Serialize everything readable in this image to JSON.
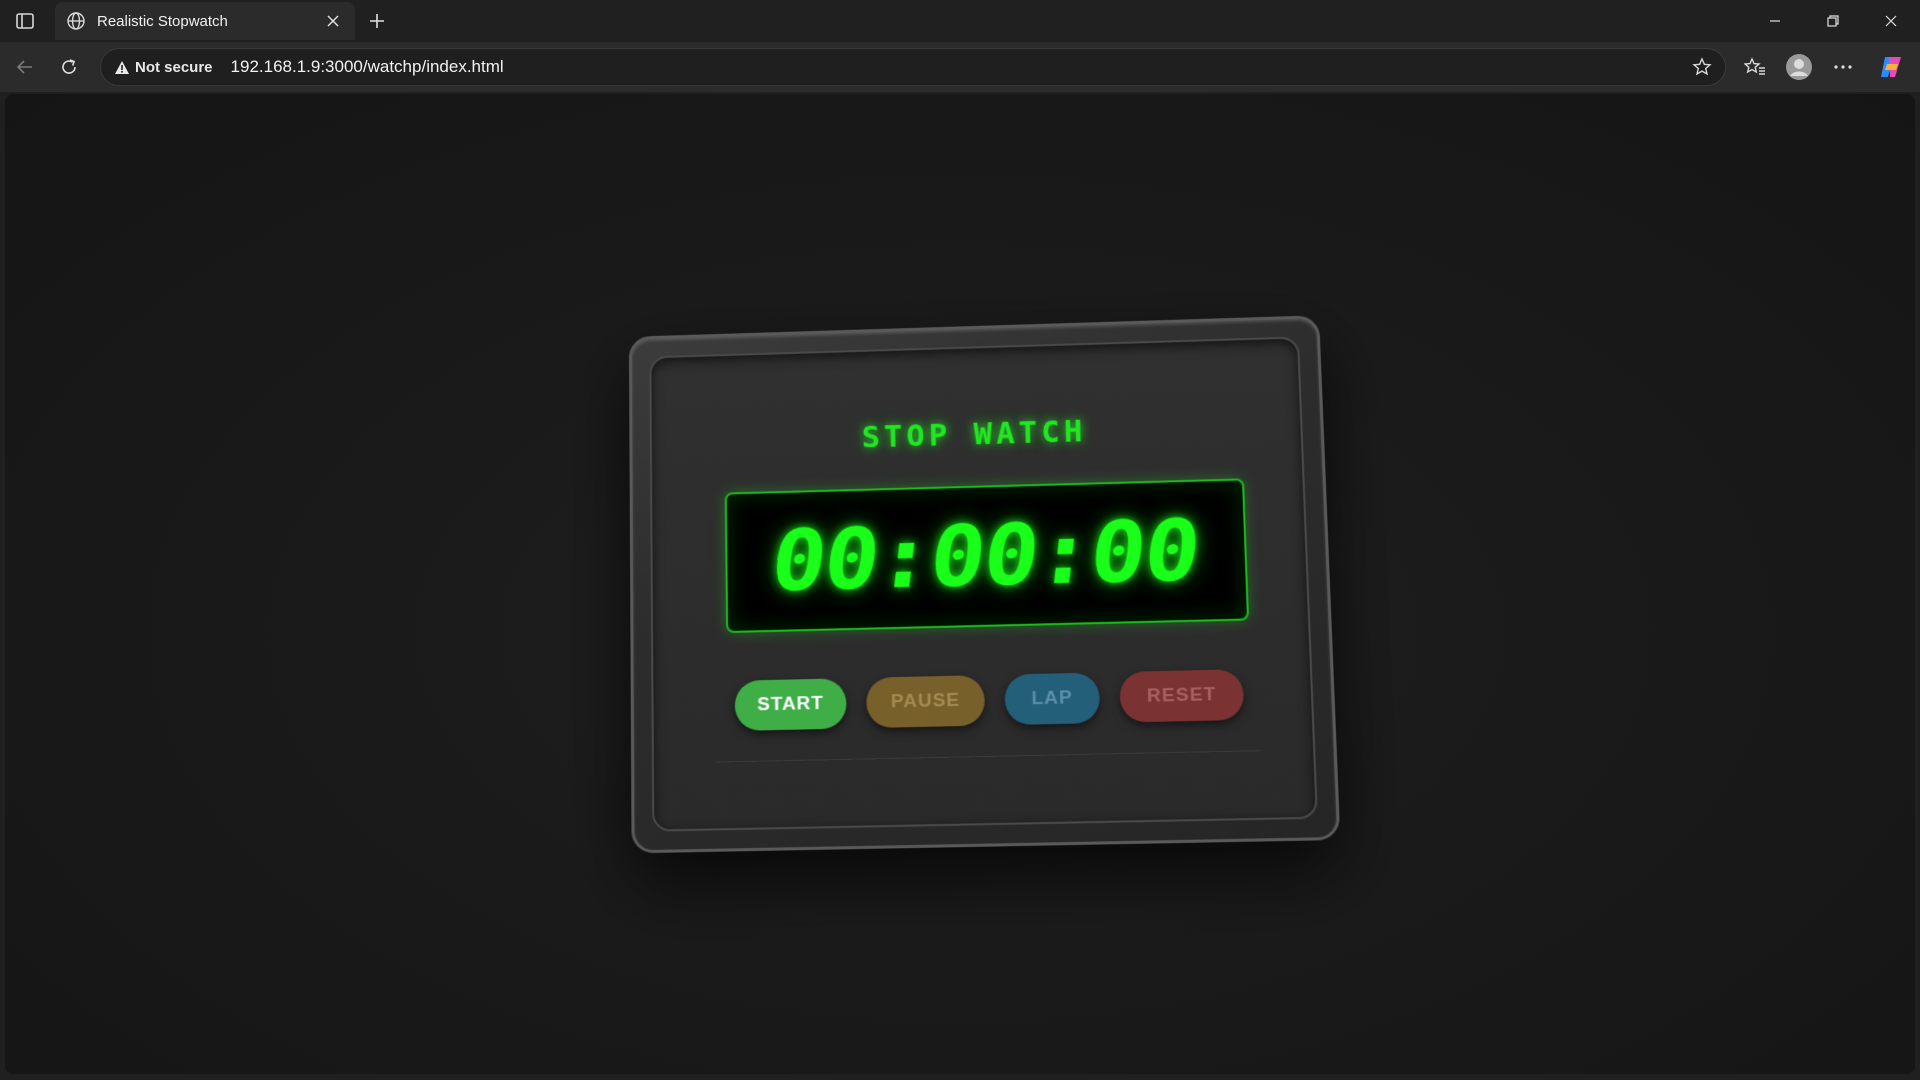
{
  "browser": {
    "tab_title": "Realistic Stopwatch",
    "security_label": "Not secure",
    "url": "192.168.1.9:3000/watchp/index.html"
  },
  "stopwatch": {
    "title": "STOP WATCH",
    "time": "00:00:00",
    "buttons": {
      "start": "START",
      "pause": "PAUSE",
      "lap": "LAP",
      "reset": "RESET"
    }
  },
  "colors": {
    "page_bg": "#191919",
    "display_green": "#1aff1a",
    "start": "#3fae47",
    "pause": "#77602a",
    "lap": "#245f7a",
    "reset": "#7a3232"
  },
  "icons": {
    "tab_actions": "tab-actions-icon",
    "favicon": "globe-icon",
    "close_tab": "close-icon",
    "new_tab": "plus-icon",
    "back": "back-arrow-icon",
    "refresh": "refresh-icon",
    "warning": "warning-icon",
    "favorite": "star-icon",
    "favorites": "favorites-icon",
    "profile": "profile-icon",
    "more": "more-icon",
    "copilot": "copilot-icon"
  }
}
